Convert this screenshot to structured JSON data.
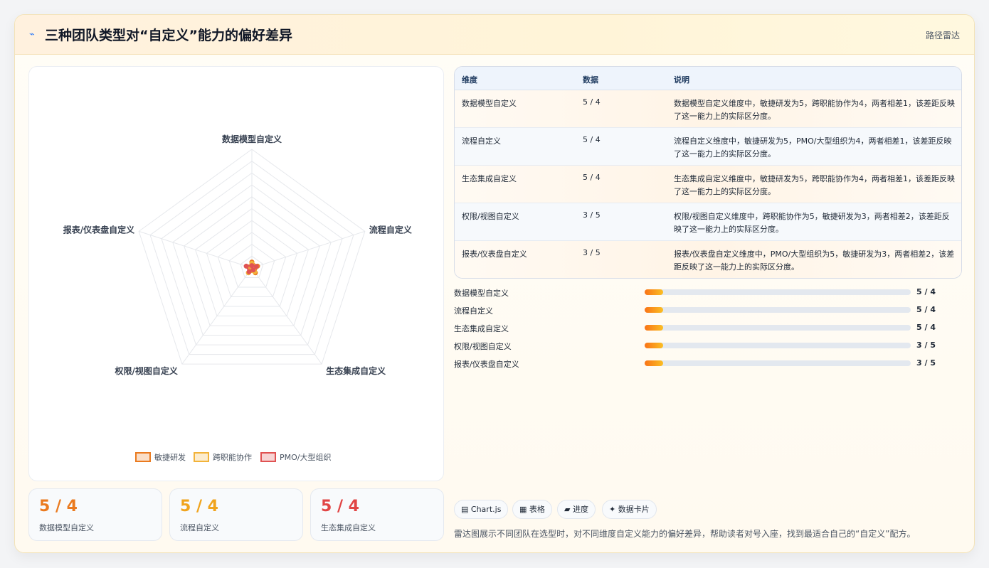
{
  "header": {
    "icon": "lightning-icon",
    "title": "三种团队类型对“自定义”能力的偏好差异",
    "badge": "路径雷达"
  },
  "chart_data": {
    "type": "radar",
    "axes": [
      "数据模型自定义",
      "流程自定义",
      "生态集成自定义",
      "权限/视图自定义",
      "报表/仪表盘自定义"
    ],
    "range": [
      0,
      100
    ],
    "grid_levels": 10,
    "series": [
      {
        "name": "敏捷研发",
        "values": [
          5,
          5,
          5,
          3,
          3
        ],
        "color": "#ea7a1f"
      },
      {
        "name": "跨职能协作",
        "values": [
          4,
          4,
          4,
          5,
          2
        ],
        "color": "#f2b33a"
      },
      {
        "name": "PMO/大型组织",
        "values": [
          2,
          4,
          2,
          4,
          5
        ],
        "color": "#e05252"
      }
    ],
    "legend_position": "bottom"
  },
  "stats": [
    {
      "value": "5 / 4",
      "label": "数据模型自定义",
      "color": "#ea7a1f"
    },
    {
      "value": "5 / 4",
      "label": "流程自定义",
      "color": "#f0a41e"
    },
    {
      "value": "5 / 4",
      "label": "生态集成自定义",
      "color": "#e14545"
    }
  ],
  "table": {
    "headers": [
      "维度",
      "数据",
      "说明"
    ],
    "rows": [
      {
        "dim": "数据模型自定义",
        "data": "5 / 4",
        "desc": "数据模型自定义维度中，敏捷研发为5，跨职能协作为4，两者相差1，该差距反映了这一能力上的实际区分度。"
      },
      {
        "dim": "流程自定义",
        "data": "5 / 4",
        "desc": "流程自定义维度中，敏捷研发为5，PMO/大型组织为4，两者相差1，该差距反映了这一能力上的实际区分度。"
      },
      {
        "dim": "生态集成自定义",
        "data": "5 / 4",
        "desc": "生态集成自定义维度中，敏捷研发为5，跨职能协作为4，两者相差1，该差距反映了这一能力上的实际区分度。"
      },
      {
        "dim": "权限/视图自定义",
        "data": "3 / 5",
        "desc": "权限/视图自定义维度中，跨职能协作为5，敏捷研发为3，两者相差2，该差距反映了这一能力上的实际区分度。"
      },
      {
        "dim": "报表/仪表盘自定义",
        "data": "3 / 5",
        "desc": "报表/仪表盘自定义维度中，PMO/大型组织为5，敏捷研发为3，两者相差2，该差距反映了这一能力上的实际区分度。"
      }
    ]
  },
  "progress": [
    {
      "label": "数据模型自定义",
      "value": "5 / 4",
      "fill": 0.07
    },
    {
      "label": "流程自定义",
      "value": "5 / 4",
      "fill": 0.07
    },
    {
      "label": "生态集成自定义",
      "value": "5 / 4",
      "fill": 0.07
    },
    {
      "label": "权限/视图自定义",
      "value": "3 / 5",
      "fill": 0.07
    },
    {
      "label": "报表/仪表盘自定义",
      "value": "3 / 5",
      "fill": 0.07
    }
  ],
  "tags": [
    {
      "icon": "chart-icon",
      "glyph": "▤",
      "label": "Chart.js"
    },
    {
      "icon": "table-icon",
      "glyph": "▦",
      "label": "表格"
    },
    {
      "icon": "progress-icon",
      "glyph": "▰",
      "label": "进度"
    },
    {
      "icon": "sparkle-icon",
      "glyph": "✦",
      "label": "数据卡片"
    }
  ],
  "footnote": "雷达图展示不同团队在选型时，对不同维度自定义能力的偏好差异，帮助读者对号入座，找到最适合自己的“自定义”配方。"
}
